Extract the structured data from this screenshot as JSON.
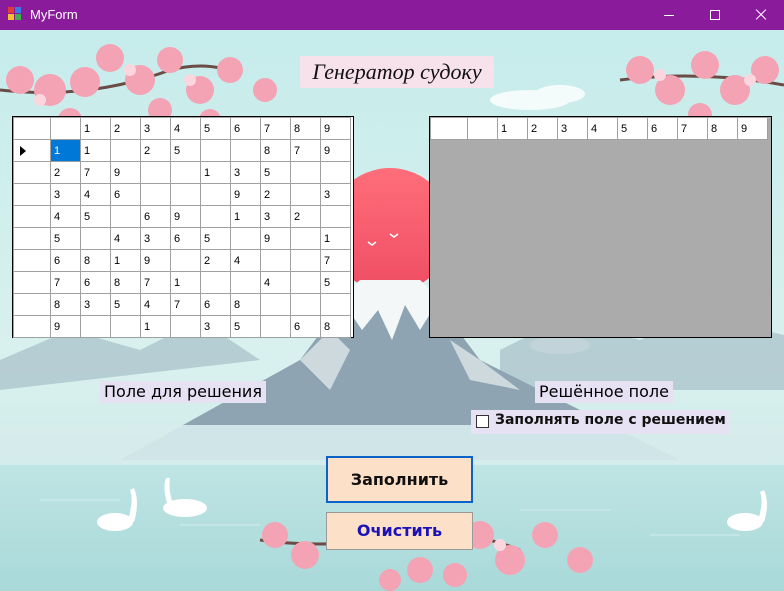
{
  "window": {
    "title": "MyForm",
    "accent": "#8a1c9c"
  },
  "heading": "Генератор судоку",
  "grid_columns": [
    "1",
    "2",
    "3",
    "4",
    "5",
    "6",
    "7",
    "8",
    "9"
  ],
  "input_grid": [
    [
      "1",
      "1",
      "",
      "2",
      "5",
      "",
      "",
      "8",
      "7",
      "9"
    ],
    [
      "2",
      "7",
      "9",
      "",
      "",
      "1",
      "3",
      "5",
      "",
      ""
    ],
    [
      "3",
      "4",
      "6",
      "",
      "",
      "",
      "9",
      "2",
      "",
      "3"
    ],
    [
      "4",
      "5",
      "",
      "6",
      "9",
      "",
      "1",
      "3",
      "2",
      ""
    ],
    [
      "5",
      "",
      "4",
      "3",
      "6",
      "5",
      "",
      "9",
      "",
      "1"
    ],
    [
      "6",
      "8",
      "1",
      "9",
      "",
      "2",
      "4",
      "",
      "",
      "7"
    ],
    [
      "7",
      "6",
      "8",
      "7",
      "1",
      "",
      "",
      "4",
      "",
      "5"
    ],
    [
      "8",
      "3",
      "5",
      "4",
      "7",
      "6",
      "8",
      "",
      "",
      ""
    ],
    [
      "9",
      "",
      "",
      "1",
      "",
      "3",
      "5",
      "",
      "6",
      "8"
    ]
  ],
  "labels": {
    "input_field": "Поле для решения",
    "solved_field": "Решённое поле",
    "fill_with_solution": "Заполнять поле с решением"
  },
  "checkbox": {
    "checked": false
  },
  "buttons": {
    "fill": "Заполнить",
    "clear": "Очистить"
  }
}
